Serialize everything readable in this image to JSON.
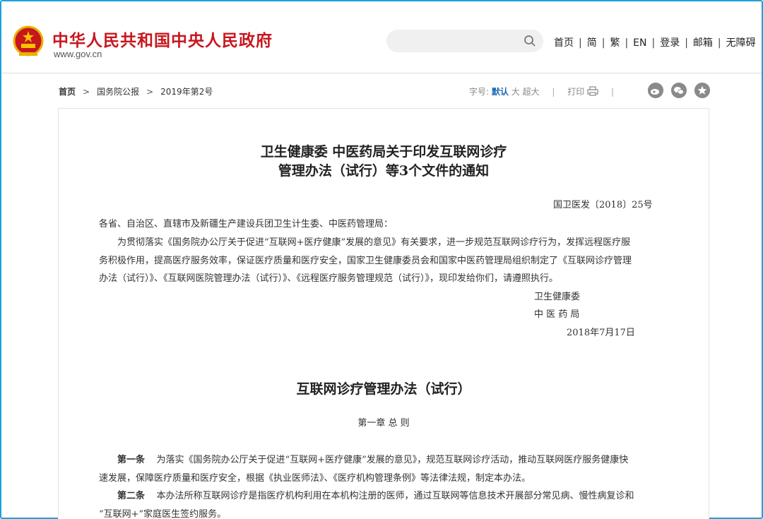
{
  "header": {
    "site_title": "中华人民共和国中央人民政府",
    "site_url": "www.gov.cn",
    "search_placeholder": "",
    "links": [
      "首页",
      "简",
      "繁",
      "EN",
      "登录",
      "邮箱",
      "无障碍"
    ],
    "brand_color": "#c8161d"
  },
  "breadcrumb": {
    "items": [
      "首页",
      "国务院公报",
      "2019年第2号"
    ]
  },
  "toolbar": {
    "font_size_label": "字号:",
    "font_default": "默认",
    "font_large": "大",
    "font_xlarge": "超大",
    "print_label": "打印",
    "share_icons": [
      "weibo-icon",
      "wechat-icon",
      "favorite-icon"
    ]
  },
  "document": {
    "title_line1": "卫生健康委  中医药局关于印发互联网诊疗",
    "title_line2": "管理办法（试行）等3个文件的通知",
    "doc_number": "国卫医发〔2018〕25号",
    "salutation": "各省、自治区、直辖市及新疆生产建设兵团卫生计生委、中医药管理局：",
    "body_line1": "为贯彻落实《国务院办公厅关于促进“互联网+医疗健康”发展的意见》有关要求，进一步规范互联网诊疗行为，发挥远程医疗服",
    "body_line2": "务积极作用，提高医疗服务效率，保证医疗质量和医疗安全，国家卫生健康委员会和国家中医药管理局组织制定了《互联网诊疗管理",
    "body_line3": "办法（试行）》、《互联网医院管理办法（试行）》、《远程医疗服务管理规范（试行）》，现印发给你们，请遵照执行。",
    "signer1": "卫生健康委",
    "signer2": "中 医 药 局",
    "date": "2018年7月17日",
    "section_title": "互联网诊疗管理办法（试行）",
    "chapter": "第一章    总      则",
    "article1_label": "第一条",
    "article1_line1": "为落实《国务院办公厅关于促进“互联网+医疗健康”发展的意见》，规范互联网诊疗活动，推动互联网医疗服务健康快",
    "article1_line2": "速发展，保障医疗质量和医疗安全，根据《执业医师法》、《医疗机构管理条例》等法律法规，制定本办法。",
    "article2_label": "第二条",
    "article2_line1": "本办法所称互联网诊疗是指医疗机构利用在本机构注册的医师，通过互联网等信息技术开展部分常见病、慢性病复诊和",
    "article2_line2": "“互联网+”家庭医生签约服务。"
  }
}
